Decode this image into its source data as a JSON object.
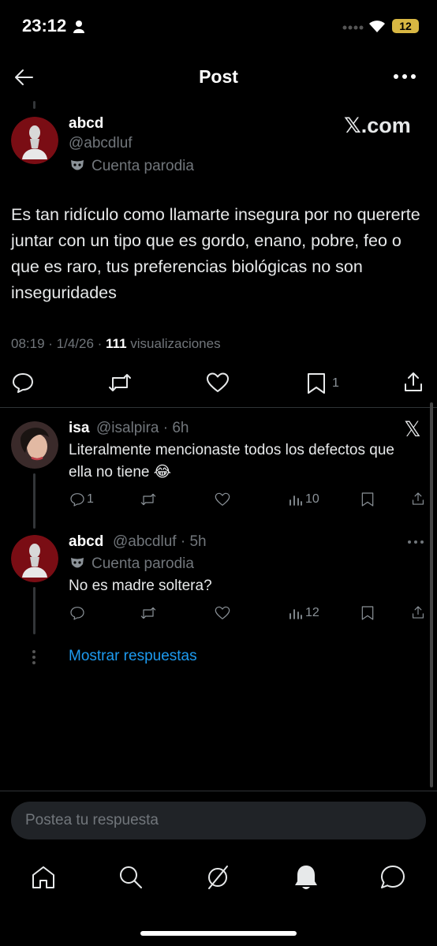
{
  "status": {
    "time": "23:12",
    "battery": "12"
  },
  "header": {
    "title": "Post",
    "back_icon": "arrow-left-icon",
    "more_icon": "more-horizontal-icon"
  },
  "post": {
    "name": "abcd",
    "handle": "@abcdluf",
    "badge": "Cuenta parodia",
    "watermark": "𝕏.com",
    "text": "Es tan ridículo como llamarte insegura por no quererte juntar con un tipo que es gordo, enano, pobre, feo o que es raro, tus preferencias biológicas no son inseguridades",
    "time": "08:19 · 1/4/26 · ",
    "views_count": "111",
    "views_label": " visualizaciones",
    "bookmarks": "1"
  },
  "replies": [
    {
      "name": "isa",
      "meta": "@isalpira · 6h",
      "text": "Literalmente mencionaste todos los defectos que ella no tiene 😂",
      "comments": "1",
      "views": "10"
    },
    {
      "name": "abcd",
      "meta": "@abcdluf · 5h",
      "badge": "Cuenta parodia",
      "text": "No es madre soltera?",
      "views": "12"
    }
  ],
  "show_replies": "Mostrar respuestas",
  "reply_box": {
    "placeholder": "Postea tu respuesta"
  },
  "colors": {
    "background": "#000000",
    "link": "#1d9bf0",
    "secondary": "#71767b",
    "battery": "#d8b743"
  }
}
